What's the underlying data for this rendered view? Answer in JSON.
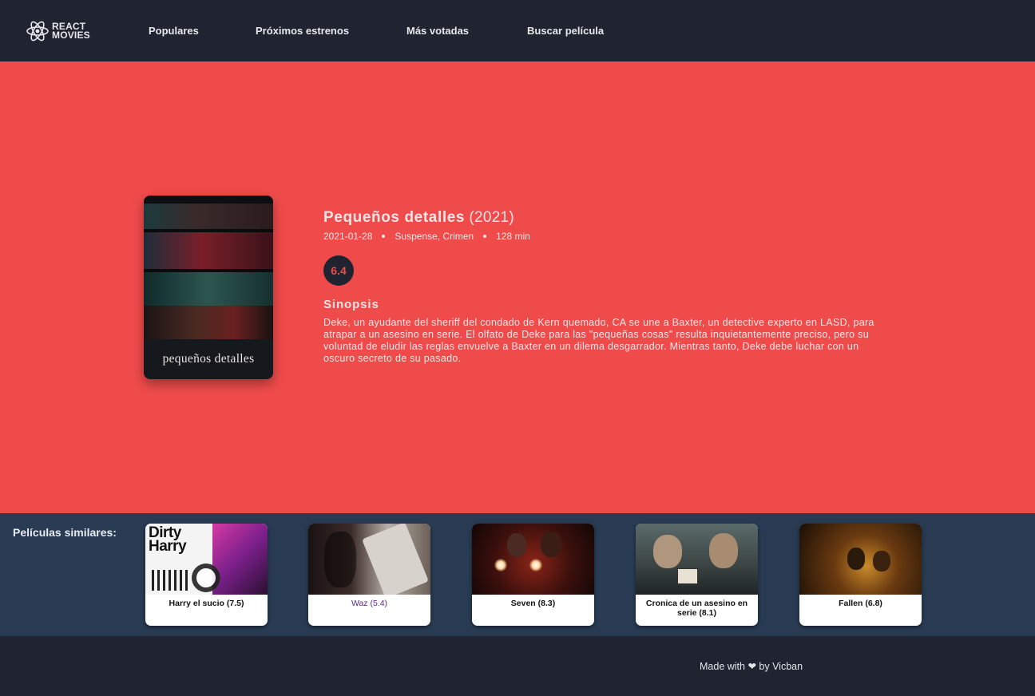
{
  "nav": {
    "logo_line1": "REACT",
    "logo_line2": "MOVIES",
    "items": [
      {
        "label": "Populares"
      },
      {
        "label": "Próximos estrenos"
      },
      {
        "label": "Más votadas"
      },
      {
        "label": "Buscar película"
      }
    ]
  },
  "movie": {
    "title": "Pequeños detalles",
    "year": "(2021)",
    "date": "2021-01-28",
    "genres": "Suspense, Crimen",
    "runtime": "128 min",
    "rating": "6.4",
    "poster_caption": "pequeños detalles",
    "synopsis_title": "Sinopsis",
    "synopsis": "Deke, un ayudante del sheriff del condado de Kern quemado, CA se une a Baxter, un detective experto en LASD, para atrapar a un asesino en serie. El olfato de Deke para las \"pequeñas cosas\" resulta inquietantemente preciso, pero su voluntad de eludir las reglas envuelve a Baxter en un dilema desgarrador. Mientras tanto, Deke debe luchar con un oscuro secreto de su pasado."
  },
  "similar": {
    "label": "Películas similares:",
    "items": [
      {
        "label": "Harry el sucio (7.5)",
        "poster_text": "Dirty Harry"
      },
      {
        "label": "Waz (5.4)"
      },
      {
        "label": "Seven (8.3)"
      },
      {
        "label": "Cronica de un asesino en serie (8.1)"
      },
      {
        "label": "Fallen (6.8)"
      }
    ]
  },
  "footer": {
    "text": "Made with ❤ by Vicban"
  },
  "colors": {
    "hero_bg": "#ef4b4b",
    "nav_bg": "#1f2430",
    "similar_bg": "#283b52"
  }
}
